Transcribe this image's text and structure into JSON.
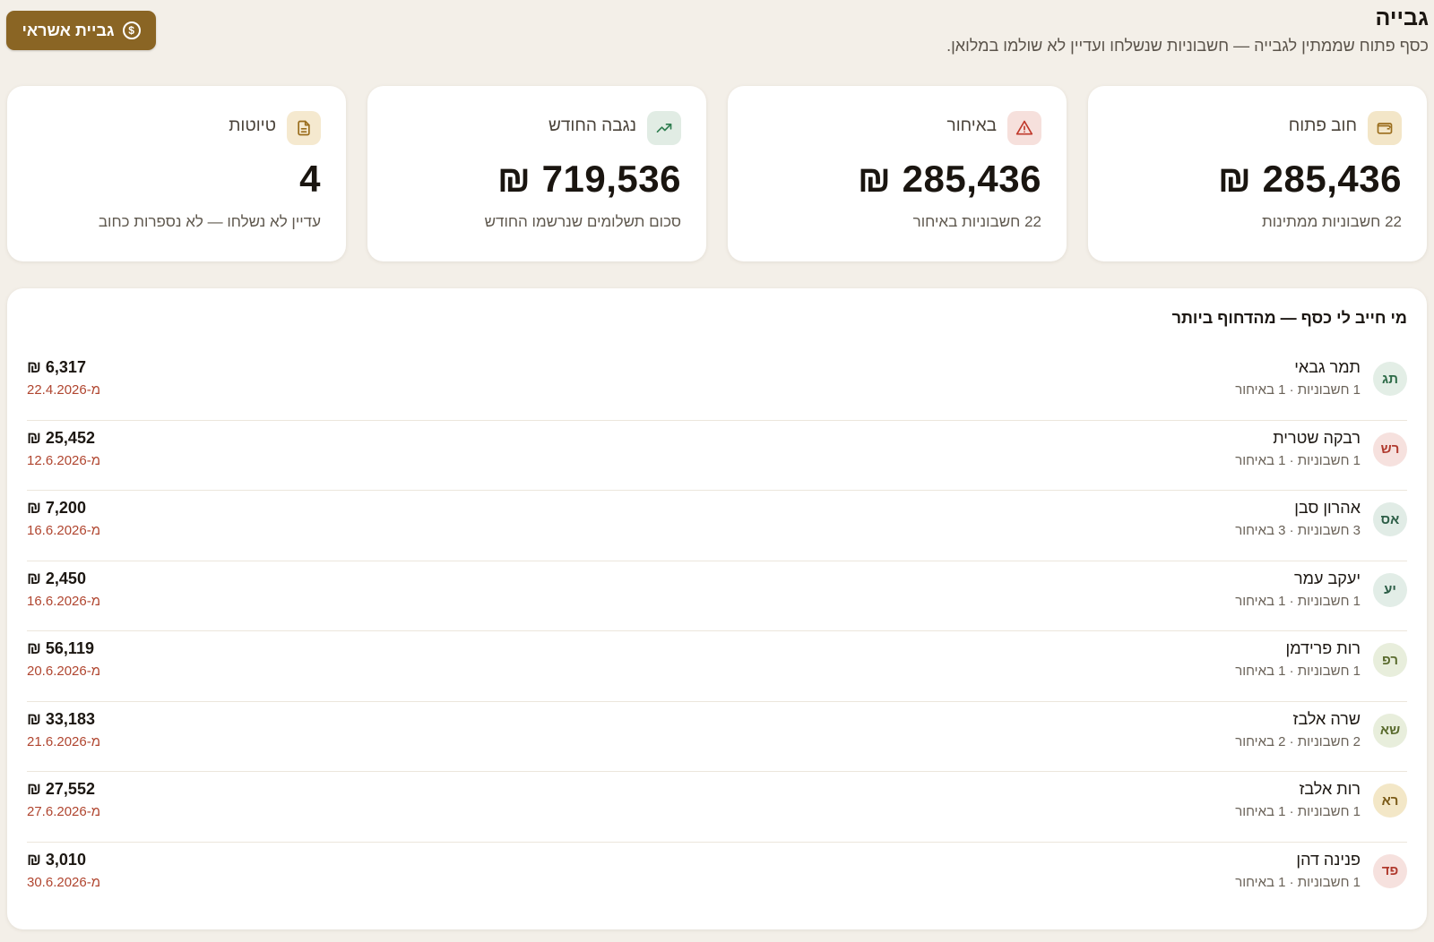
{
  "header": {
    "title": "גבייה",
    "subtitle": "כסף פתוח שממתין לגבייה — חשבוניות שנשלחו ועדיין לא שולמו במלואן.",
    "collect_button_label": "גביית אשראי",
    "collect_button_icon": "dollar-coin-icon"
  },
  "cards": [
    {
      "label": "חוב פתוח",
      "value": "285,436 ₪",
      "note": "22 חשבוניות ממתינות",
      "icon": "wallet-icon",
      "icon_color": "#9a6d1c"
    },
    {
      "label": "באיחור",
      "value": "285,436 ₪",
      "note": "22 חשבוניות באיחור",
      "icon": "alert-triangle-icon",
      "icon_color": "#c0392b"
    },
    {
      "label": "נגבה החודש",
      "value": "719,536 ₪",
      "note": "סכום תשלומים שנרשמו החודש",
      "icon": "trending-up-icon",
      "icon_color": "#2e7d4f"
    },
    {
      "label": "טיוטות",
      "value": "4",
      "note": "עדיין לא נשלחו — לא נספרות כחוב",
      "icon": "document-icon",
      "icon_color": "#9a6d1c"
    }
  ],
  "debtors": {
    "title": "מי חייב לי כסף — מהדחוף ביותר",
    "rows": [
      {
        "initials": "תג",
        "name": "תמר גבאי",
        "meta": "1 חשבוניות · 1 באיחור",
        "amount": "₪ 6,317",
        "since": "מ-22.4.2026",
        "avatar_bg": "#e3eee6",
        "avatar_fg": "#2e6b48"
      },
      {
        "initials": "רש",
        "name": "רבקה שטרית",
        "meta": "1 חשבוניות · 1 באיחור",
        "amount": "₪ 25,452",
        "since": "מ-12.6.2026",
        "avatar_bg": "#f6e1de",
        "avatar_fg": "#b03a2e"
      },
      {
        "initials": "אס",
        "name": "אהרון סבן",
        "meta": "3 חשבוניות · 3 באיחור",
        "amount": "₪ 7,200",
        "since": "מ-16.6.2026",
        "avatar_bg": "#e1ece6",
        "avatar_fg": "#2d5e47"
      },
      {
        "initials": "יע",
        "name": "יעקב עמר",
        "meta": "1 חשבוניות · 1 באיחור",
        "amount": "₪ 2,450",
        "since": "מ-16.6.2026",
        "avatar_bg": "#e2ede7",
        "avatar_fg": "#2d5e47"
      },
      {
        "initials": "רפ",
        "name": "רות פרידמן",
        "meta": "1 חשבוניות · 1 באיחור",
        "amount": "₪ 56,119",
        "since": "מ-20.6.2026",
        "avatar_bg": "#e8eedc",
        "avatar_fg": "#5a6b2e"
      },
      {
        "initials": "שא",
        "name": "שרה אלבז",
        "meta": "2 חשבוניות · 2 באיחור",
        "amount": "₪ 33,183",
        "since": "מ-21.6.2026",
        "avatar_bg": "#e8eedc",
        "avatar_fg": "#5a6b2e"
      },
      {
        "initials": "רא",
        "name": "רות אלבז",
        "meta": "1 חשבוניות · 1 באיחור",
        "amount": "₪ 27,552",
        "since": "מ-27.6.2026",
        "avatar_bg": "#f3e7c7",
        "avatar_fg": "#7a5a17"
      },
      {
        "initials": "פד",
        "name": "פנינה דהן",
        "meta": "1 חשבוניות · 1 באיחור",
        "amount": "₪ 3,010",
        "since": "מ-30.6.2026",
        "avatar_bg": "#f6e1de",
        "avatar_fg": "#b03a2e"
      }
    ]
  }
}
